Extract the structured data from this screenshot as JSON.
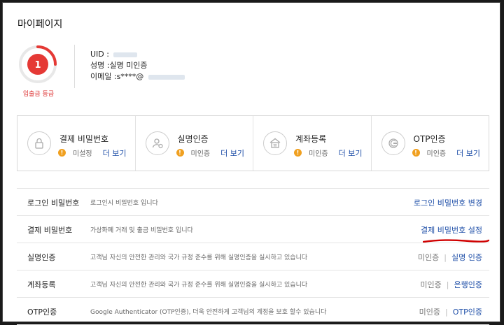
{
  "page": {
    "title": "마이페이지"
  },
  "level": {
    "value": "1",
    "caption": "입출금 등급",
    "accent": "#e53935"
  },
  "profile": {
    "uid_label": "UID :",
    "name_label": "성명 :",
    "name_value": "실명 미인증",
    "email_label": "이메일 :",
    "email_value": "s****@",
    "masked_text_color": "#dfe6ee"
  },
  "cards": [
    {
      "icon": "lock-icon",
      "title": "결제 비밀번호",
      "status": "미설정",
      "link": "더 보기"
    },
    {
      "icon": "user-check-icon",
      "title": "실명인증",
      "status": "미인증",
      "link": "더 보기"
    },
    {
      "icon": "house-icon",
      "title": "계좌등록",
      "status": "미인증",
      "link": "더 보기"
    },
    {
      "icon": "otp-icon",
      "title": "OTP인증",
      "status": "미인증",
      "link": "더 보기"
    }
  ],
  "warn_icon_char": "!",
  "rows": [
    {
      "name": "로그인 비밀번호",
      "desc": "로그인시 비밀번호 입니다",
      "status": "",
      "action": "로그인 비밀번호 변경"
    },
    {
      "name": "결제 비밀번호",
      "desc": "가상화폐 거래 및 출금 비밀번호 입니다",
      "status": "",
      "action": "결제 비밀번호 설정"
    },
    {
      "name": "실명인증",
      "desc": "고객님 자신의 안전한 관리와 국가 규정 준수를 위해 실명인증을 실시하고 있습니다",
      "status": "미인증",
      "action": "실명 인증"
    },
    {
      "name": "계좌등록",
      "desc": "고객님 자신의 안전한 관리와 국가 규정 준수를 위해 실명인증을 실시하고 있습니다",
      "status": "미인증",
      "action": "은행인증"
    },
    {
      "name": "OTP인증",
      "desc": "Google Authenticator (OTP인증), 더욱 안전하게 고객님의 계정을 보호 할수 있습니다",
      "status": "미인증",
      "action": "OTP인증"
    }
  ],
  "colors": {
    "link": "#1f4fa8",
    "warn": "#f0a020",
    "annotation": "#d00000"
  }
}
